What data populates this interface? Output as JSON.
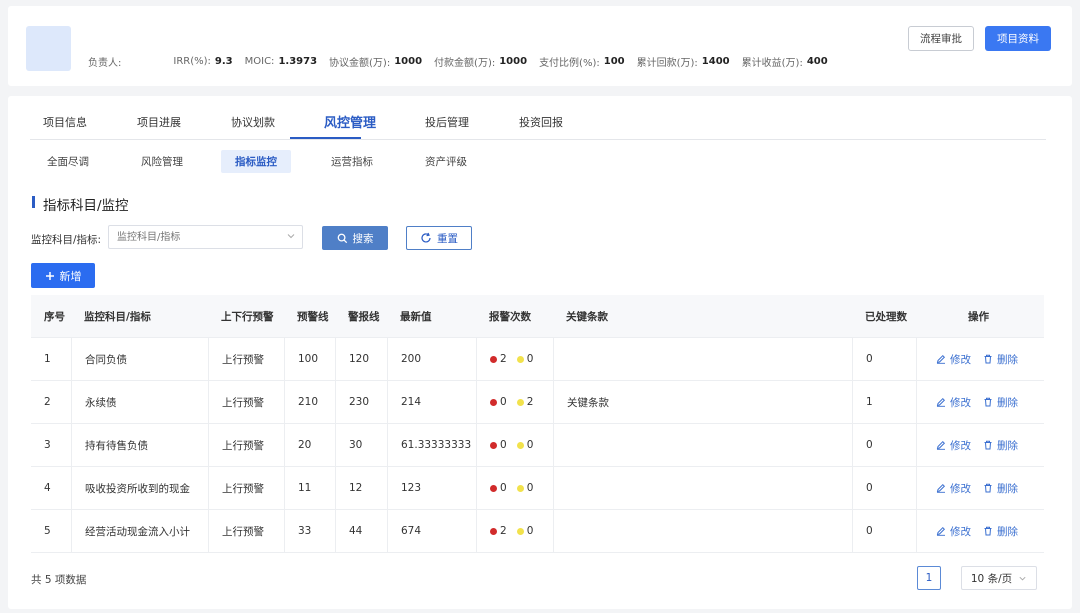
{
  "header": {
    "stats": [
      {
        "label": "负责人:",
        "value": ""
      },
      {
        "label": "IRR(%):",
        "value": "9.3"
      },
      {
        "label": "MOIC:",
        "value": "1.3973"
      },
      {
        "label": "协议金额(万):",
        "value": "1000"
      },
      {
        "label": "付款金额(万):",
        "value": "1000"
      },
      {
        "label": "支付比例(%):",
        "value": "100"
      },
      {
        "label": "累计回款(万):",
        "value": "1400"
      },
      {
        "label": "累计收益(万):",
        "value": "400"
      }
    ],
    "btn_flow": "流程审批",
    "btn_docs": "项目资料"
  },
  "tabs": [
    "项目信息",
    "项目进展",
    "协议划款",
    "风控管理",
    "投后管理",
    "投资回报"
  ],
  "subtabs": [
    "全面尽调",
    "风险管理",
    "指标监控",
    "运营指标",
    "资产评级"
  ],
  "section_title": "指标科目/监控",
  "filter": {
    "label": "监控科目/指标:",
    "placeholder": "监控科目/指标",
    "search": "搜索",
    "reset": "重置"
  },
  "add_label": "新增",
  "table": {
    "headers": [
      "序号",
      "监控科目/指标",
      "上下行预警",
      "预警线",
      "警报线",
      "最新值",
      "报警次数",
      "关键条款",
      "已处理数",
      "操作"
    ],
    "rows": [
      {
        "no": "1",
        "name": "合同负债",
        "dir": "上行预警",
        "warn": "100",
        "alarm": "120",
        "latest": "200",
        "red": "2",
        "yellow": "0",
        "clause": "",
        "handled": "0"
      },
      {
        "no": "2",
        "name": "永续债",
        "dir": "上行预警",
        "warn": "210",
        "alarm": "230",
        "latest": "214",
        "red": "0",
        "yellow": "2",
        "clause": "关键条款",
        "handled": "1"
      },
      {
        "no": "3",
        "name": "持有待售负债",
        "dir": "上行预警",
        "warn": "20",
        "alarm": "30",
        "latest": "61.33333333",
        "red": "0",
        "yellow": "0",
        "clause": "",
        "handled": "0"
      },
      {
        "no": "4",
        "name": "吸收投资所收到的现金",
        "dir": "上行预警",
        "warn": "11",
        "alarm": "12",
        "latest": "123",
        "red": "0",
        "yellow": "0",
        "clause": "",
        "handled": "0"
      },
      {
        "no": "5",
        "name": "经营活动现金流入小计",
        "dir": "上行预警",
        "warn": "33",
        "alarm": "44",
        "latest": "674",
        "red": "2",
        "yellow": "0",
        "clause": "",
        "handled": "0"
      }
    ],
    "edit_label": "修改",
    "delete_label": "删除"
  },
  "footer": {
    "total": "共 5 项数据",
    "page": "1",
    "page_size": "10 条/页"
  }
}
